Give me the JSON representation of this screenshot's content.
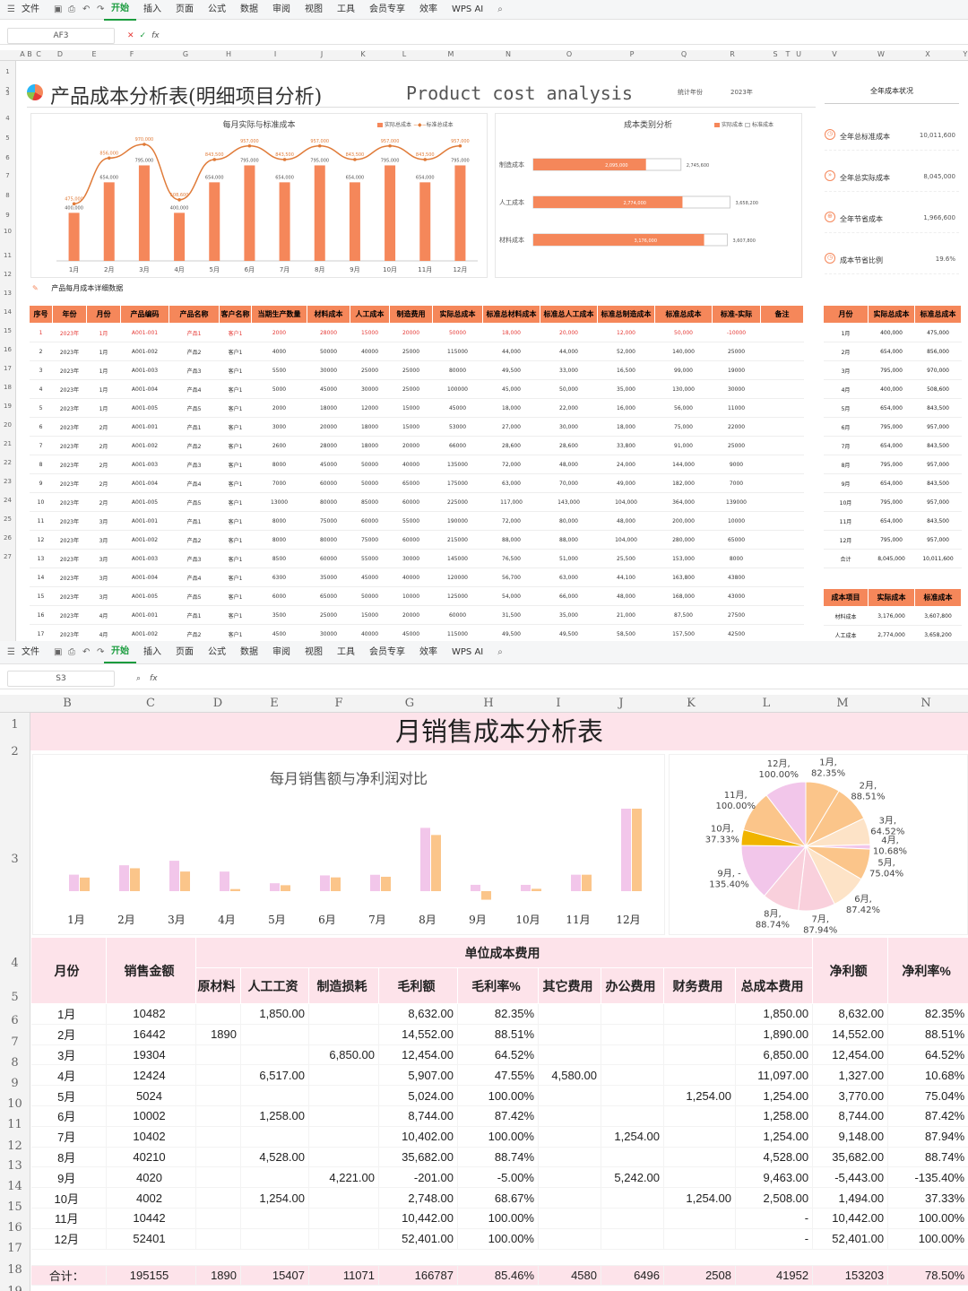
{
  "top": {
    "menu": [
      "文件",
      "开始",
      "插入",
      "页面",
      "公式",
      "数据",
      "审阅",
      "视图",
      "工具",
      "会员专享",
      "效率",
      "WPS AI"
    ],
    "active_menu": "开始",
    "cell_ref": "AF3",
    "columns": [
      "A",
      "B",
      "C",
      "D",
      "E",
      "F",
      "G",
      "H",
      "I",
      "J",
      "K",
      "L",
      "M",
      "N",
      "O",
      "P",
      "Q",
      "R",
      "S",
      "T",
      "U",
      "V",
      "W",
      "X",
      "Y"
    ],
    "title_cn": "产品成本分析表(明细项目分析)",
    "title_en": "Product cost analysis",
    "year_label": "统计年份",
    "year_value": "2023年",
    "chart1": {
      "title": "每月实际与标准成本",
      "legend_actual": "实际总成本",
      "legend_std": "标准总成本",
      "months": [
        "1月",
        "2月",
        "3月",
        "4月",
        "5月",
        "6月",
        "7月",
        "8月",
        "9月",
        "10月",
        "11月",
        "12月"
      ],
      "actual": [
        400000,
        654000,
        795000,
        400000,
        654000,
        795000,
        654000,
        795000,
        654000,
        795000,
        654000,
        795000
      ],
      "standard": [
        475000,
        856000,
        970000,
        508600,
        843500,
        957000,
        843500,
        957000,
        843500,
        957000,
        843500,
        957000
      ],
      "actual_labels": [
        "400,000",
        "654,000",
        "795,000",
        "400,000",
        "654,000",
        "795,000",
        "654,000",
        "795,000",
        "654,000",
        "795,000",
        "654,000",
        "795,000"
      ],
      "standard_labels": [
        "475,000",
        "856,000",
        "970,000",
        "508,600",
        "843,500",
        "957,000",
        "843,500",
        "957,000",
        "843,500",
        "957,000",
        "843,500",
        "957,000"
      ]
    },
    "chart2": {
      "title": "成本类别分析",
      "legend_actual": "实际成本",
      "legend_std": "标准成本",
      "categories": [
        "制造成本",
        "人工成本",
        "材料成本"
      ],
      "actual": [
        2095000,
        2774000,
        3176000
      ],
      "standard": [
        2745600,
        3658200,
        3607800
      ],
      "actual_labels": [
        "2,095,000",
        "2,774,000",
        "3,176,000"
      ],
      "standard_labels": [
        "2,745,600",
        "3,658,200",
        "3,607,800"
      ]
    },
    "summary_title": "全年成本状况",
    "kpis": [
      {
        "label": "全年总标准成本",
        "value": "10,011,600"
      },
      {
        "label": "全年总实际成本",
        "value": "8,045,000"
      },
      {
        "label": "全年节省成本",
        "value": "1,966,600"
      },
      {
        "label": "成本节省比例",
        "value": "19.6%"
      }
    ],
    "detail_title": "产品每月成本详细数据",
    "detail_headers": [
      "序号",
      "年份",
      "月份",
      "产品编码",
      "产品名称",
      "客户名称",
      "当期生产数量",
      "材料成本",
      "人工成本",
      "制造费用",
      "实际总成本",
      "标准总材料成本",
      "标准总人工成本",
      "标准总制造成本",
      "标准总成本",
      "标准-实际",
      "备注"
    ],
    "detail_rows": [
      [
        "1",
        "2023年",
        "1月",
        "A001-001",
        "产品1",
        "客户1",
        "2000",
        "28000",
        "15000",
        "20000",
        "50000",
        "18,000",
        "20,000",
        "12,000",
        "50,000",
        "-10000",
        ""
      ],
      [
        "2",
        "2023年",
        "1月",
        "A001-002",
        "产品2",
        "客户1",
        "4000",
        "50000",
        "40000",
        "25000",
        "115000",
        "44,000",
        "44,000",
        "52,000",
        "140,000",
        "25000",
        ""
      ],
      [
        "3",
        "2023年",
        "1月",
        "A001-003",
        "产品3",
        "客户1",
        "5500",
        "30000",
        "25000",
        "25000",
        "80000",
        "49,500",
        "33,000",
        "16,500",
        "99,000",
        "19000",
        ""
      ],
      [
        "4",
        "2023年",
        "1月",
        "A001-004",
        "产品4",
        "客户1",
        "5000",
        "45000",
        "30000",
        "25000",
        "100000",
        "45,000",
        "50,000",
        "35,000",
        "130,000",
        "30000",
        ""
      ],
      [
        "5",
        "2023年",
        "1月",
        "A001-005",
        "产品5",
        "客户1",
        "2000",
        "18000",
        "12000",
        "15000",
        "45000",
        "18,000",
        "22,000",
        "16,000",
        "56,000",
        "11000",
        ""
      ],
      [
        "6",
        "2023年",
        "2月",
        "A001-001",
        "产品1",
        "客户1",
        "3000",
        "20000",
        "18000",
        "15000",
        "53000",
        "27,000",
        "30,000",
        "18,000",
        "75,000",
        "22000",
        ""
      ],
      [
        "7",
        "2023年",
        "2月",
        "A001-002",
        "产品2",
        "客户1",
        "2600",
        "28000",
        "18000",
        "20000",
        "66000",
        "28,600",
        "28,600",
        "33,800",
        "91,000",
        "25000",
        ""
      ],
      [
        "8",
        "2023年",
        "2月",
        "A001-003",
        "产品3",
        "客户1",
        "8000",
        "45000",
        "50000",
        "40000",
        "135000",
        "72,000",
        "48,000",
        "24,000",
        "144,000",
        "9000",
        ""
      ],
      [
        "9",
        "2023年",
        "2月",
        "A001-004",
        "产品4",
        "客户1",
        "7000",
        "60000",
        "50000",
        "65000",
        "175000",
        "63,000",
        "70,000",
        "49,000",
        "182,000",
        "7000",
        ""
      ],
      [
        "10",
        "2023年",
        "2月",
        "A001-005",
        "产品5",
        "客户1",
        "13000",
        "80000",
        "85000",
        "60000",
        "225000",
        "117,000",
        "143,000",
        "104,000",
        "364,000",
        "139000",
        ""
      ],
      [
        "11",
        "2023年",
        "3月",
        "A001-001",
        "产品1",
        "客户1",
        "8000",
        "75000",
        "60000",
        "55000",
        "190000",
        "72,000",
        "80,000",
        "48,000",
        "200,000",
        "10000",
        ""
      ],
      [
        "12",
        "2023年",
        "3月",
        "A001-002",
        "产品2",
        "客户1",
        "8000",
        "80000",
        "75000",
        "60000",
        "215000",
        "88,000",
        "88,000",
        "104,000",
        "280,000",
        "65000",
        ""
      ],
      [
        "13",
        "2023年",
        "3月",
        "A001-003",
        "产品3",
        "客户1",
        "8500",
        "60000",
        "55000",
        "30000",
        "145000",
        "76,500",
        "51,000",
        "25,500",
        "153,000",
        "8000",
        ""
      ],
      [
        "14",
        "2023年",
        "3月",
        "A001-004",
        "产品4",
        "客户1",
        "6300",
        "35000",
        "45000",
        "40000",
        "120000",
        "56,700",
        "63,000",
        "44,100",
        "163,800",
        "43800",
        ""
      ],
      [
        "15",
        "2023年",
        "3月",
        "A001-005",
        "产品5",
        "客户1",
        "6000",
        "65000",
        "50000",
        "10000",
        "125000",
        "54,000",
        "66,000",
        "48,000",
        "168,000",
        "43000",
        ""
      ],
      [
        "16",
        "2023年",
        "4月",
        "A001-001",
        "产品1",
        "客户1",
        "3500",
        "25000",
        "15000",
        "20000",
        "60000",
        "31,500",
        "35,000",
        "21,000",
        "87,500",
        "27500",
        ""
      ],
      [
        "17",
        "2023年",
        "4月",
        "A001-002",
        "产品2",
        "客户1",
        "4500",
        "30000",
        "40000",
        "45000",
        "115000",
        "49,500",
        "49,500",
        "58,500",
        "157,500",
        "42500",
        ""
      ]
    ],
    "side_headers": [
      "月份",
      "实际总成本",
      "标准总成本"
    ],
    "side_rows": [
      [
        "1月",
        "400,000",
        "475,000"
      ],
      [
        "2月",
        "654,000",
        "856,000"
      ],
      [
        "3月",
        "795,000",
        "970,000"
      ],
      [
        "4月",
        "400,000",
        "508,600"
      ],
      [
        "5月",
        "654,000",
        "843,500"
      ],
      [
        "6月",
        "795,000",
        "957,000"
      ],
      [
        "7月",
        "654,000",
        "843,500"
      ],
      [
        "8月",
        "795,000",
        "957,000"
      ],
      [
        "9月",
        "654,000",
        "843,500"
      ],
      [
        "10月",
        "795,000",
        "957,000"
      ],
      [
        "11月",
        "654,000",
        "843,500"
      ],
      [
        "12月",
        "795,000",
        "957,000"
      ],
      [
        "合计",
        "8,045,000",
        "10,011,600"
      ]
    ],
    "side2_headers": [
      "成本项目",
      "实际成本",
      "标准成本"
    ],
    "side2_rows": [
      [
        "材料成本",
        "3,176,000",
        "3,607,800"
      ],
      [
        "人工成本",
        "2,774,000",
        "3,658,200"
      ]
    ]
  },
  "bottom": {
    "menu": [
      "文件",
      "开始",
      "插入",
      "页面",
      "公式",
      "数据",
      "审阅",
      "视图",
      "工具",
      "会员专享",
      "效率",
      "WPS AI"
    ],
    "active_menu": "开始",
    "cell_ref": "S3",
    "columns": [
      "B",
      "C",
      "D",
      "E",
      "F",
      "G",
      "H",
      "I",
      "J",
      "K",
      "L",
      "M",
      "N"
    ],
    "title": "月销售成本分析表",
    "chart_title": "每月销售额与净利润对比",
    "group_header": "单位成本费用",
    "headers": {
      "month": "月份",
      "sales": "销售金额",
      "material": "原材料",
      "labor": "人工工资",
      "mfg": "制造损耗",
      "gross": "毛利额",
      "gross_rate": "毛利率%",
      "other": "其它费用",
      "office": "办公费用",
      "finance": "财务费用",
      "total_cost": "总成本费用",
      "net": "净利额",
      "net_rate": "净利率%"
    },
    "rows": [
      [
        "1月",
        "10482",
        "",
        "1,850.00",
        "",
        "8,632.00",
        "82.35%",
        "",
        "",
        "",
        "1,850.00",
        "8,632.00",
        "82.35%"
      ],
      [
        "2月",
        "16442",
        "1890",
        "",
        "",
        "14,552.00",
        "88.51%",
        "",
        "",
        "",
        "1,890.00",
        "14,552.00",
        "88.51%"
      ],
      [
        "3月",
        "19304",
        "",
        "",
        "6,850.00",
        "12,454.00",
        "64.52%",
        "",
        "",
        "",
        "6,850.00",
        "12,454.00",
        "64.52%"
      ],
      [
        "4月",
        "12424",
        "",
        "6,517.00",
        "",
        "5,907.00",
        "47.55%",
        "4,580.00",
        "",
        "",
        "11,097.00",
        "1,327.00",
        "10.68%"
      ],
      [
        "5月",
        "5024",
        "",
        "",
        "",
        "5,024.00",
        "100.00%",
        "",
        "",
        "1,254.00",
        "1,254.00",
        "3,770.00",
        "75.04%"
      ],
      [
        "6月",
        "10002",
        "",
        "1,258.00",
        "",
        "8,744.00",
        "87.42%",
        "",
        "",
        "",
        "1,258.00",
        "8,744.00",
        "87.42%"
      ],
      [
        "7月",
        "10402",
        "",
        "",
        "",
        "10,402.00",
        "100.00%",
        "",
        "1,254.00",
        "",
        "1,254.00",
        "9,148.00",
        "87.94%"
      ],
      [
        "8月",
        "40210",
        "",
        "4,528.00",
        "",
        "35,682.00",
        "88.74%",
        "",
        "",
        "",
        "4,528.00",
        "35,682.00",
        "88.74%"
      ],
      [
        "9月",
        "4020",
        "",
        "",
        "4,221.00",
        "-201.00",
        "-5.00%",
        "",
        "5,242.00",
        "",
        "9,463.00",
        "-5,443.00",
        "-135.40%"
      ],
      [
        "10月",
        "4002",
        "",
        "1,254.00",
        "",
        "2,748.00",
        "68.67%",
        "",
        "",
        "1,254.00",
        "2,508.00",
        "1,494.00",
        "37.33%"
      ],
      [
        "11月",
        "10442",
        "",
        "",
        "",
        "10,442.00",
        "100.00%",
        "",
        "",
        "",
        "-",
        "10,442.00",
        "100.00%"
      ],
      [
        "12月",
        "52401",
        "",
        "",
        "",
        "52,401.00",
        "100.00%",
        "",
        "",
        "",
        "-",
        "52,401.00",
        "100.00%"
      ]
    ],
    "total": [
      "合计：",
      "195155",
      "1890",
      "15407",
      "11071",
      "166787",
      "85.46%",
      "4580",
      "6496",
      "2508",
      "41952",
      "153203",
      "78.50%"
    ],
    "row_numbers": [
      "1",
      "2",
      "3",
      "4",
      "5",
      "6",
      "7",
      "8",
      "9",
      "10",
      "11",
      "12",
      "13",
      "14",
      "15",
      "16",
      "17",
      "18",
      "19"
    ],
    "pie_labels": [
      "1月,\n82.35%",
      "2月,\n88.51%",
      "3月,\n64.52%",
      "4月,\n10.68%",
      "5月,\n75.04%",
      "6月,\n87.42%",
      "7月,\n87.94%",
      "8月,\n88.74%",
      "9月, -\n135.40%",
      "10月,\n37.33%",
      "11月,\n100.00%",
      "12月,\n100.00%"
    ],
    "colors": {
      "sales": "#f2c6ea",
      "net": "#fbc58a",
      "pink": "#fde3ea",
      "orange": "#f5875a"
    }
  },
  "chart_data": [
    {
      "type": "bar",
      "title": "每月实际与标准成本",
      "categories": [
        "1月",
        "2月",
        "3月",
        "4月",
        "5月",
        "6月",
        "7月",
        "8月",
        "9月",
        "10月",
        "11月",
        "12月"
      ],
      "series": [
        {
          "name": "实际总成本",
          "values": [
            400000,
            654000,
            795000,
            400000,
            654000,
            795000,
            654000,
            795000,
            654000,
            795000,
            654000,
            795000
          ]
        },
        {
          "name": "标准总成本",
          "values": [
            475000,
            856000,
            970000,
            508600,
            843500,
            957000,
            843500,
            957000,
            843500,
            957000,
            843500,
            957000
          ]
        }
      ]
    },
    {
      "type": "bar",
      "title": "成本类别分析",
      "categories": [
        "制造成本",
        "人工成本",
        "材料成本"
      ],
      "series": [
        {
          "name": "实际成本",
          "values": [
            2095000,
            2774000,
            3176000
          ]
        },
        {
          "name": "标准成本",
          "values": [
            2745600,
            3658200,
            3607800
          ]
        }
      ]
    },
    {
      "type": "bar",
      "title": "每月销售额与净利润对比",
      "categories": [
        "1月",
        "2月",
        "3月",
        "4月",
        "5月",
        "6月",
        "7月",
        "8月",
        "9月",
        "10月",
        "11月",
        "12月"
      ],
      "series": [
        {
          "values": [
            10482,
            16442,
            19304,
            12424,
            5024,
            10002,
            10402,
            40210,
            4020,
            4002,
            10442,
            52401
          ]
        },
        {
          "values": [
            8632,
            14552,
            12454,
            1327,
            3770,
            8744,
            9148,
            35682,
            -5443,
            1494,
            10442,
            52401
          ]
        }
      ]
    },
    {
      "type": "pie",
      "categories": [
        "1月",
        "2月",
        "3月",
        "4月",
        "5月",
        "6月",
        "7月",
        "8月",
        "9月",
        "10月",
        "11月",
        "12月"
      ],
      "values": [
        82.35,
        88.51,
        64.52,
        10.68,
        75.04,
        87.42,
        87.94,
        88.74,
        -135.4,
        37.33,
        100.0,
        100.0
      ]
    }
  ]
}
